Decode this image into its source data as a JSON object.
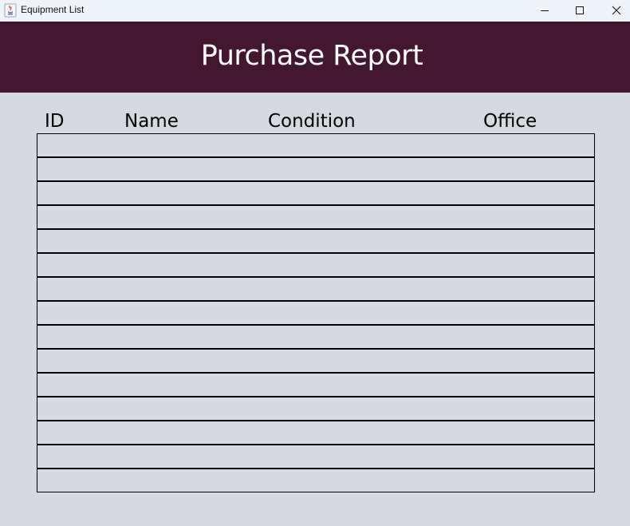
{
  "window": {
    "title": "Equipment List"
  },
  "titlebar_buttons": {
    "minimize_icon": "minimize-icon",
    "maximize_icon": "maximize-icon",
    "close_icon": "close-icon"
  },
  "header": {
    "title": "Purchase Report",
    "background": "#441731"
  },
  "table": {
    "columns": [
      "ID",
      "Name",
      "Condition",
      "Office"
    ],
    "rows": [
      [
        "",
        "",
        "",
        ""
      ],
      [
        "",
        "",
        "",
        ""
      ],
      [
        "",
        "",
        "",
        ""
      ],
      [
        "",
        "",
        "",
        ""
      ],
      [
        "",
        "",
        "",
        ""
      ],
      [
        "",
        "",
        "",
        ""
      ],
      [
        "",
        "",
        "",
        ""
      ],
      [
        "",
        "",
        "",
        ""
      ],
      [
        "",
        "",
        "",
        ""
      ],
      [
        "",
        "",
        "",
        ""
      ],
      [
        "",
        "",
        "",
        ""
      ],
      [
        "",
        "",
        "",
        ""
      ],
      [
        "",
        "",
        "",
        ""
      ],
      [
        "",
        "",
        "",
        ""
      ],
      [
        "",
        "",
        "",
        ""
      ]
    ]
  },
  "colors": {
    "page_background": "#d6d9e0",
    "titlebar_background": "#eef4f9"
  }
}
